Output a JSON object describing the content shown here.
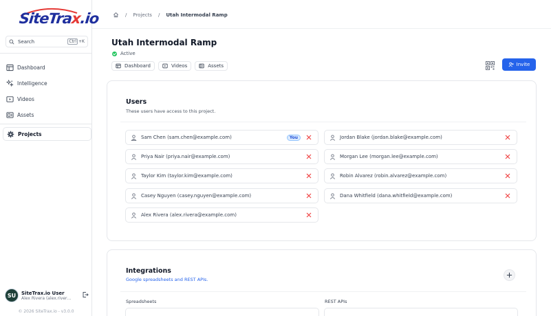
{
  "brand": {
    "logo_main": "SiteTra",
    "logo_x": "x",
    "logo_tld": ".io"
  },
  "search": {
    "label": "Search",
    "shortcut_ctrl": "Ctrl",
    "shortcut_key": "+K"
  },
  "nav": [
    {
      "label": "Dashboard",
      "icon": "dashboard-icon"
    },
    {
      "label": "Intelligence",
      "icon": "intelligence-icon"
    },
    {
      "label": "Videos",
      "icon": "video-icon"
    },
    {
      "label": "Assets",
      "icon": "assets-icon"
    },
    {
      "label": "Projects",
      "icon": "gear-icon",
      "active": true
    }
  ],
  "user": {
    "initials": "SU",
    "name": "SiteTrax.io User",
    "email": "Alex Rivera (alex.rivera@example.com)"
  },
  "footer": "© 2026 SiteTrax.io - v3.0.0",
  "breadcrumb": {
    "root": "Projects",
    "current": "Utah Intermodal Ramp",
    "sep": "/"
  },
  "project": {
    "title": "Utah Intermodal Ramp",
    "status": "Active",
    "tabs": [
      "Dashboard",
      "Videos",
      "Assets"
    ],
    "invite_label": "Invite"
  },
  "users_card": {
    "title": "Users",
    "subtitle": "These users have access to this project.",
    "you_badge": "You",
    "left": [
      {
        "label": "Sam Chen (sam.chen@example.com)",
        "you": true
      },
      {
        "label": "Priya Nair (priya.nair@example.com)"
      },
      {
        "label": "Taylor Kim (taylor.kim@example.com)"
      },
      {
        "label": "Casey Nguyen (casey.nguyen@example.com)"
      },
      {
        "label": "Alex Rivera (alex.rivera@example.com)"
      }
    ],
    "right": [
      {
        "label": "Jordan Blake (jordan.blake@example.com)"
      },
      {
        "label": "Morgan Lee (morgan.lee@example.com)"
      },
      {
        "label": "Robin Alvarez (robin.alvarez@example.com)"
      },
      {
        "label": "Dana Whitfield (dana.whitfield@example.com)"
      }
    ]
  },
  "integrations": {
    "title": "Integrations",
    "subtitle": "Google spreadsheets and REST APIs.",
    "spreadsheets_label": "Spreadsheets",
    "rest_label": "REST APIs"
  },
  "colors": {
    "accent": "#2563eb",
    "status_active": "#22c55e",
    "remove": "#ef4444",
    "avatar_bg": "#1e4038"
  }
}
